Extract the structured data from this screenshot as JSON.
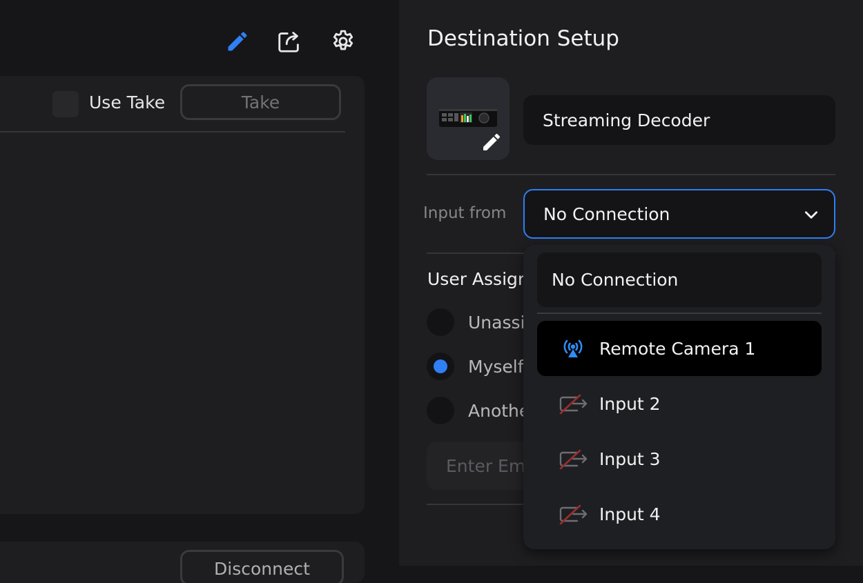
{
  "toolbar": {
    "edit_icon": "pencil-icon",
    "share_icon": "share-icon",
    "settings_icon": "gear-icon",
    "accent": "#2f7ff5"
  },
  "take_panel": {
    "use_take_label": "Use Take",
    "take_button": "Take"
  },
  "lower_panel": {
    "disconnect_button": "Disconnect"
  },
  "destination": {
    "title": "Destination Setup",
    "device_name": "Streaming Decoder",
    "input_from_label": "Input from",
    "input_from_value": "No Connection"
  },
  "user_assignment": {
    "title": "User Assign",
    "options": [
      {
        "label": "Unassig",
        "selected": false
      },
      {
        "label": "Myself",
        "selected": true
      },
      {
        "label": "Anothe",
        "selected": false
      }
    ],
    "email_placeholder": "Enter Em"
  },
  "dropdown": {
    "none_option": "No Connection",
    "items": [
      {
        "label": "Remote Camera 1",
        "icon": "remote-camera-icon",
        "active": true
      },
      {
        "label": "Input 2",
        "icon": "input-disabled-icon",
        "active": false
      },
      {
        "label": "Input 3",
        "icon": "input-disabled-icon",
        "active": false
      },
      {
        "label": "Input 4",
        "icon": "input-disabled-icon",
        "active": false
      }
    ]
  }
}
